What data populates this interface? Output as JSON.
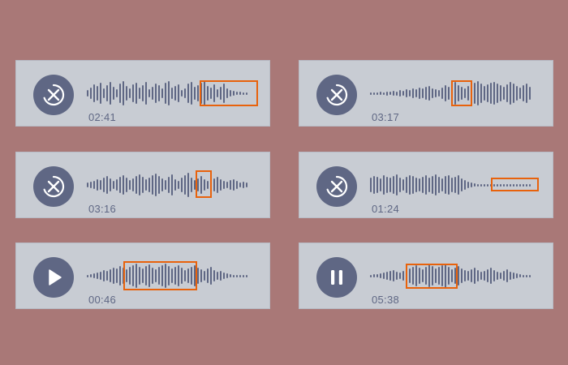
{
  "colors": {
    "background": "#a97877",
    "card": "#c8ccd3",
    "control": "#5f6784",
    "waveform": "#5f6784",
    "highlight": "#e8620c"
  },
  "players": [
    {
      "state": "loading",
      "icon": "close-icon",
      "time": "02:41"
    },
    {
      "state": "loading",
      "icon": "close-icon",
      "time": "03:17"
    },
    {
      "state": "loading",
      "icon": "close-icon",
      "time": "03:16"
    },
    {
      "state": "loading",
      "icon": "close-icon",
      "time": "01:24"
    },
    {
      "state": "paused",
      "icon": "play-icon",
      "time": "00:46"
    },
    {
      "state": "playing",
      "icon": "pause-icon",
      "time": "05:38"
    }
  ]
}
